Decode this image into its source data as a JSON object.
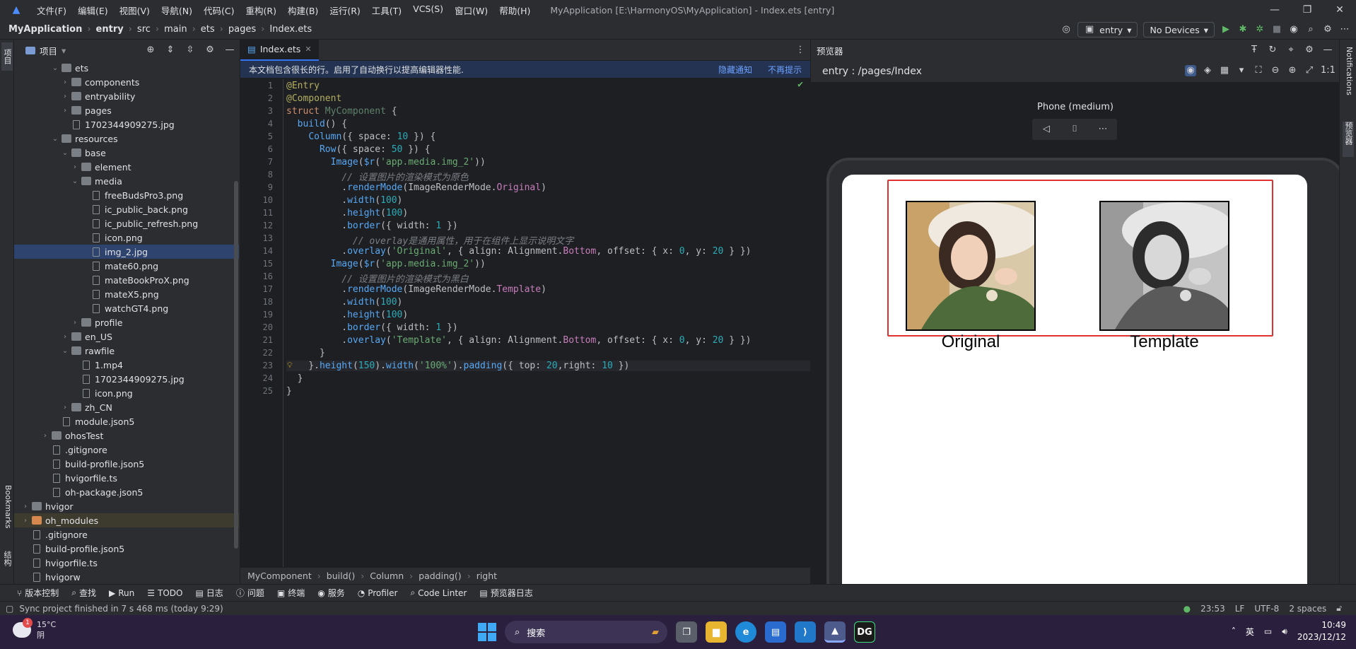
{
  "titlebar": {
    "menu": [
      "文件(F)",
      "编辑(E)",
      "视图(V)",
      "导航(N)",
      "代码(C)",
      "重构(R)",
      "构建(B)",
      "运行(R)",
      "工具(T)",
      "VCS(S)",
      "窗口(W)",
      "帮助(H)"
    ],
    "window_title": "MyApplication [E:\\HarmonyOS\\MyApplication] - Index.ets [entry]"
  },
  "navbar": {
    "crumbs": [
      "MyApplication",
      "entry",
      "src",
      "main",
      "ets",
      "pages",
      "Index.ets"
    ],
    "run_config": "entry",
    "device": "No Devices"
  },
  "leftstrip": {
    "project_tab": "项目",
    "bookmarks_tab": "Bookmarks",
    "structure_tab": "结构"
  },
  "project": {
    "title": "项目",
    "tree": [
      {
        "label": "ets",
        "depth": 4,
        "type": "folder",
        "open": true
      },
      {
        "label": "components",
        "depth": 5,
        "type": "folder",
        "open": false
      },
      {
        "label": "entryability",
        "depth": 5,
        "type": "folder",
        "open": false
      },
      {
        "label": "pages",
        "depth": 5,
        "type": "folder",
        "open": false
      },
      {
        "label": "1702344909275.jpg",
        "depth": 5,
        "type": "file"
      },
      {
        "label": "resources",
        "depth": 4,
        "type": "folder",
        "open": true
      },
      {
        "label": "base",
        "depth": 5,
        "type": "folder",
        "open": true
      },
      {
        "label": "element",
        "depth": 6,
        "type": "folder",
        "open": false
      },
      {
        "label": "media",
        "depth": 6,
        "type": "folder",
        "open": true
      },
      {
        "label": "freeBudsPro3.png",
        "depth": 7,
        "type": "file"
      },
      {
        "label": "ic_public_back.png",
        "depth": 7,
        "type": "file"
      },
      {
        "label": "ic_public_refresh.png",
        "depth": 7,
        "type": "file"
      },
      {
        "label": "icon.png",
        "depth": 7,
        "type": "file"
      },
      {
        "label": "img_2.jpg",
        "depth": 7,
        "type": "file",
        "selected": true
      },
      {
        "label": "mate60.png",
        "depth": 7,
        "type": "file"
      },
      {
        "label": "mateBookProX.png",
        "depth": 7,
        "type": "file"
      },
      {
        "label": "mateX5.png",
        "depth": 7,
        "type": "file"
      },
      {
        "label": "watchGT4.png",
        "depth": 7,
        "type": "file"
      },
      {
        "label": "profile",
        "depth": 6,
        "type": "folder",
        "open": false
      },
      {
        "label": "en_US",
        "depth": 5,
        "type": "folder",
        "open": false
      },
      {
        "label": "rawfile",
        "depth": 5,
        "type": "folder",
        "open": true
      },
      {
        "label": "1.mp4",
        "depth": 6,
        "type": "file"
      },
      {
        "label": "1702344909275.jpg",
        "depth": 6,
        "type": "file"
      },
      {
        "label": "icon.png",
        "depth": 6,
        "type": "file"
      },
      {
        "label": "zh_CN",
        "depth": 5,
        "type": "folder",
        "open": false
      },
      {
        "label": "module.json5",
        "depth": 4,
        "type": "file"
      },
      {
        "label": "ohosTest",
        "depth": 3,
        "type": "folder",
        "open": false
      },
      {
        "label": ".gitignore",
        "depth": 3,
        "type": "file"
      },
      {
        "label": "build-profile.json5",
        "depth": 3,
        "type": "file"
      },
      {
        "label": "hvigorfile.ts",
        "depth": 3,
        "type": "file"
      },
      {
        "label": "oh-package.json5",
        "depth": 3,
        "type": "file"
      },
      {
        "label": "hvigor",
        "depth": 1,
        "type": "folder",
        "open": false
      },
      {
        "label": "oh_modules",
        "depth": 1,
        "type": "folder",
        "open": false,
        "highlight": true
      },
      {
        "label": ".gitignore",
        "depth": 1,
        "type": "file"
      },
      {
        "label": "build-profile.json5",
        "depth": 1,
        "type": "file"
      },
      {
        "label": "hvigorfile.ts",
        "depth": 1,
        "type": "file"
      },
      {
        "label": "hvigorw",
        "depth": 1,
        "type": "file"
      }
    ]
  },
  "editor": {
    "tab": "Index.ets",
    "notice": "本文档包含很长的行。启用了自动换行以提高编辑器性能.",
    "notice_hide": "隐藏通知",
    "notice_dismiss": "不再提示",
    "line_numbers": [
      "1",
      "2",
      "3",
      "4",
      "5",
      "6",
      "7",
      "8",
      "9",
      "10",
      "11",
      "12",
      "13",
      "14",
      "15",
      "16",
      "17",
      "18",
      "19",
      "20",
      "21",
      "22",
      "23",
      "24",
      "25"
    ],
    "breadcrumbs": [
      "MyComponent",
      "build()",
      "Column",
      "padding()",
      "right"
    ]
  },
  "previewer": {
    "title": "预览器",
    "route": "entry : /pages/Index",
    "device": "Phone (medium)",
    "captions": {
      "original": "Original",
      "template": "Template"
    }
  },
  "rightstrip": {
    "notifications": "Notifications",
    "previewer": "预览器"
  },
  "bottomtabs": [
    "版本控制",
    "查找",
    "Run",
    "TODO",
    "日志",
    "问题",
    "终端",
    "服务",
    "Profiler",
    "Code Linter",
    "预览器日志"
  ],
  "statusbar": {
    "message": "Sync project finished in 7 s 468 ms (today 9:29)",
    "position": "23:53",
    "line_sep": "LF",
    "encoding": "UTF-8",
    "indent": "2 spaces"
  },
  "taskbar": {
    "temp": "15°C",
    "weather": "阴",
    "badge": "1",
    "search": "搜索",
    "ime": "英",
    "time": "10:49",
    "date": "2023/12/12"
  }
}
